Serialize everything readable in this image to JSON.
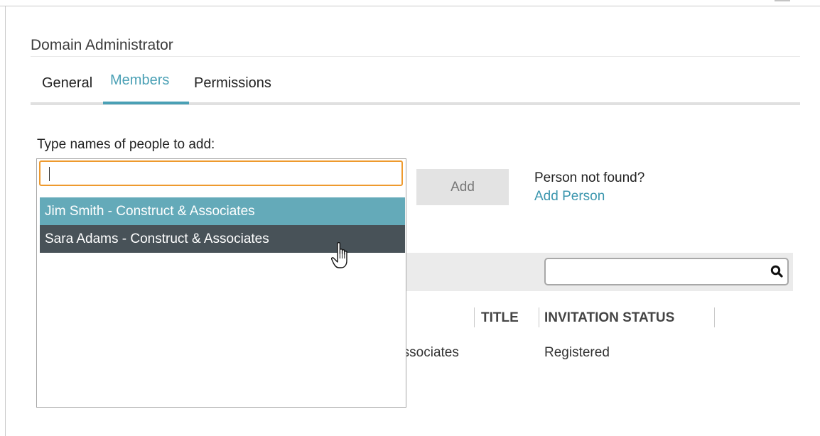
{
  "dialog": {
    "title": "Domain Administrator"
  },
  "tabs": [
    {
      "label": "General",
      "active": false
    },
    {
      "label": "Members",
      "active": true
    },
    {
      "label": "Permissions",
      "active": false
    }
  ],
  "members": {
    "add_label": "Type names of people to add:",
    "input": {
      "value": "",
      "placeholder": ""
    },
    "suggestions": [
      {
        "label": "Jim Smith - Construct & Associates",
        "state": "highlighted"
      },
      {
        "label": "Sara Adams - Construct & Associates",
        "state": "hovered"
      }
    ],
    "add_button": "Add",
    "not_found_text": "Person not found?",
    "add_person_link": "Add Person"
  },
  "table": {
    "search": {
      "value": "",
      "placeholder": ""
    },
    "columns": [
      "TITLE",
      "INVITATION STATUS"
    ],
    "rows": [
      {
        "company_fragment": "Associates",
        "status": "Registered"
      }
    ]
  },
  "colors": {
    "accent": "#4aa0b5",
    "focus_border": "#ee9a2e",
    "option_highlight": "#64aab9",
    "option_hover": "#485258"
  },
  "icons": [
    "search-icon",
    "hand-cursor-icon",
    "minimize-icon",
    "close-icon"
  ]
}
